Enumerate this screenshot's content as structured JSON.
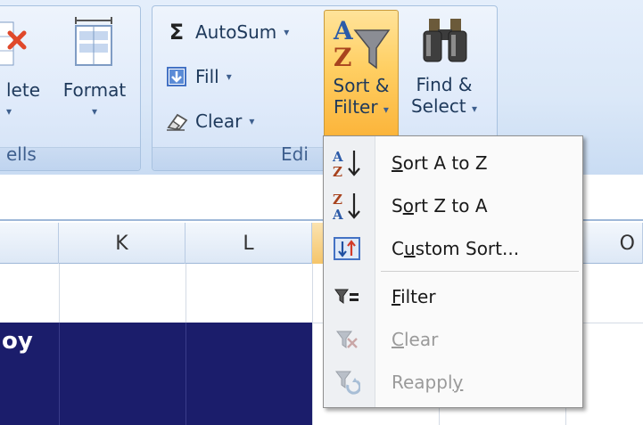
{
  "ribbon": {
    "cells_group": {
      "label": "ells",
      "delete_label": "lete",
      "format_label": "Format",
      "caret": "▾"
    },
    "editing_group": {
      "label": "Edi",
      "autosum_label": "AutoSum",
      "fill_label": "Fill",
      "clear_label": "Clear",
      "sort_filter_line1": "Sort &",
      "sort_filter_line2": "Filter",
      "find_select_line1": "Find &",
      "find_select_line2": "Select",
      "sigma": "Σ",
      "caret": "▾"
    }
  },
  "grid": {
    "columns": [
      "K",
      "L",
      "O"
    ],
    "cell_text": "oy",
    "colors": {
      "navy_fill": "#1b1d6b",
      "selected_header": "#f5c56a"
    }
  },
  "sort_menu": {
    "items": [
      {
        "label": "Sort A to Z",
        "access_key_index": 0,
        "icon": "sort-az-icon",
        "enabled": true
      },
      {
        "label": "Sort Z to A",
        "access_key_index": 1,
        "icon": "sort-za-icon",
        "enabled": true
      },
      {
        "label": "Custom Sort...",
        "access_key_index": 1,
        "icon": "custom-sort-icon",
        "enabled": true
      },
      {
        "label": "Filter",
        "access_key_index": 0,
        "icon": "filter-icon",
        "enabled": true
      },
      {
        "label": "Clear",
        "access_key_index": 0,
        "icon": "clear-filter-icon",
        "enabled": false
      },
      {
        "label": "Reapply",
        "access_key_index": 6,
        "icon": "reapply-icon",
        "enabled": false
      }
    ]
  }
}
